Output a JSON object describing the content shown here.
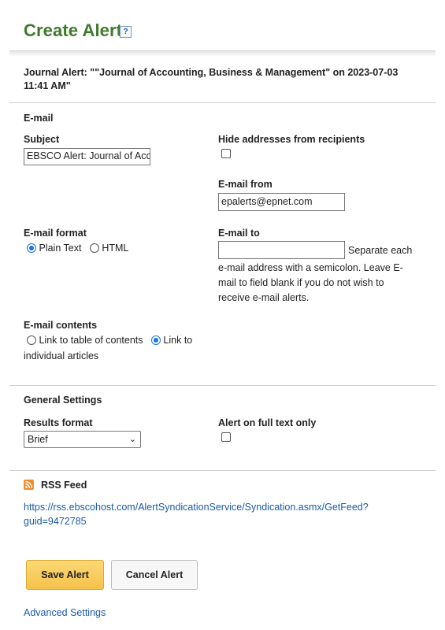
{
  "header": {
    "title": "Create Alert",
    "help_glyph": "?"
  },
  "alert": {
    "journal_line1": "Journal Alert: \"\"Journal of Accounting, Business & Management\" on 2023-07-03",
    "journal_line2": "11:41 AM\""
  },
  "email": {
    "section_title": "E-mail",
    "subject_label": "Subject",
    "subject_value": "EBSCO Alert: Journal of Acc",
    "hide_label": "Hide addresses from recipients",
    "hide_checked": false,
    "from_label": "E-mail from",
    "from_value": "epalerts@epnet.com",
    "format_label": "E-mail format",
    "format_options": [
      "Plain Text",
      "HTML"
    ],
    "format_selected": "Plain Text",
    "to_label": "E-mail to",
    "to_value": "",
    "to_hint_line1": "Separate each",
    "to_hint_line2": "e-mail address with a semicolon. Leave E-",
    "to_hint_line3": "mail to field blank if you do not wish to",
    "to_hint_line4": "receive e-mail alerts.",
    "contents_label": "E-mail contents",
    "contents_option1": "Link to table of contents",
    "contents_option2": "Link to",
    "contents_option2_cont": "individual articles",
    "contents_selected": "Link to individual articles"
  },
  "general": {
    "section_title": "General Settings",
    "results_label": "Results format",
    "results_value": "Brief",
    "fulltext_label": "Alert on full text only",
    "fulltext_checked": false
  },
  "rss": {
    "title": "RSS Feed",
    "url_line1": "https://rss.ebscohost.com/AlertSyndicationService/Syndication.asmx/GetFeed?",
    "url_line2": "guid=9472785"
  },
  "actions": {
    "save_label": "Save Alert",
    "cancel_label": "Cancel Alert",
    "advanced_label": "Advanced Settings"
  },
  "colors": {
    "title_green": "#3f7a2a",
    "link_blue": "#1c5aa7",
    "save_yellow": "#f5c24a",
    "radio_blue": "#1a73e8",
    "rss_orange": "#f08c2d"
  }
}
